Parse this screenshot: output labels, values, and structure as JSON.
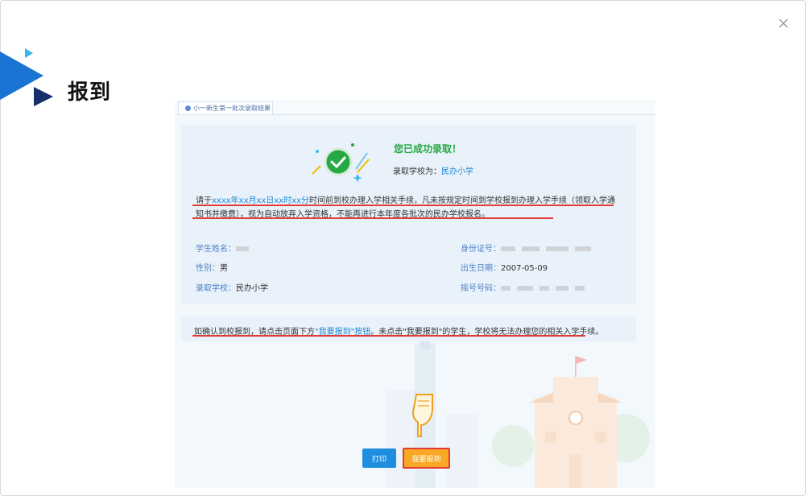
{
  "page": {
    "title": "报到"
  },
  "tab": {
    "label": "小一新生第一批次录取结果"
  },
  "result": {
    "title": "您已成功录取！",
    "school_label": "录取学校为：",
    "school_name": "民办小学"
  },
  "notice": {
    "pre": "请于",
    "deadline": "xxxx年xx月xx日xx时xx分",
    "body": "时间前到校办理入学相关手续，凡未按规定时间到学校报到办理入学手续（领取入学通知书并缴费），视为自动放弃入学资格，不能再进行本年度各批次的民办学校报名。"
  },
  "student": {
    "name_label": "学生姓名：",
    "gender_label": "性别：",
    "gender_value": "男",
    "school_label": "录取学校：",
    "school_value": "民办小学",
    "id_label": "身份证号：",
    "birth_label": "出生日期：",
    "birth_value": "2007-05-09",
    "lottery_label": "摇号号码："
  },
  "confirm": {
    "pre": "如确认到校报到，请点击页面下方",
    "link": "\"我要报到\"按钮",
    "post": "。未点击\"我要报到\"的学生，学校将无法办理您的相关入学手续。"
  },
  "buttons": {
    "print": "打印",
    "report": "我要报到"
  },
  "colors": {
    "accent": "#1e88d6",
    "success": "#26a844",
    "warning": "#f9a825",
    "highlight": "#e53935"
  }
}
